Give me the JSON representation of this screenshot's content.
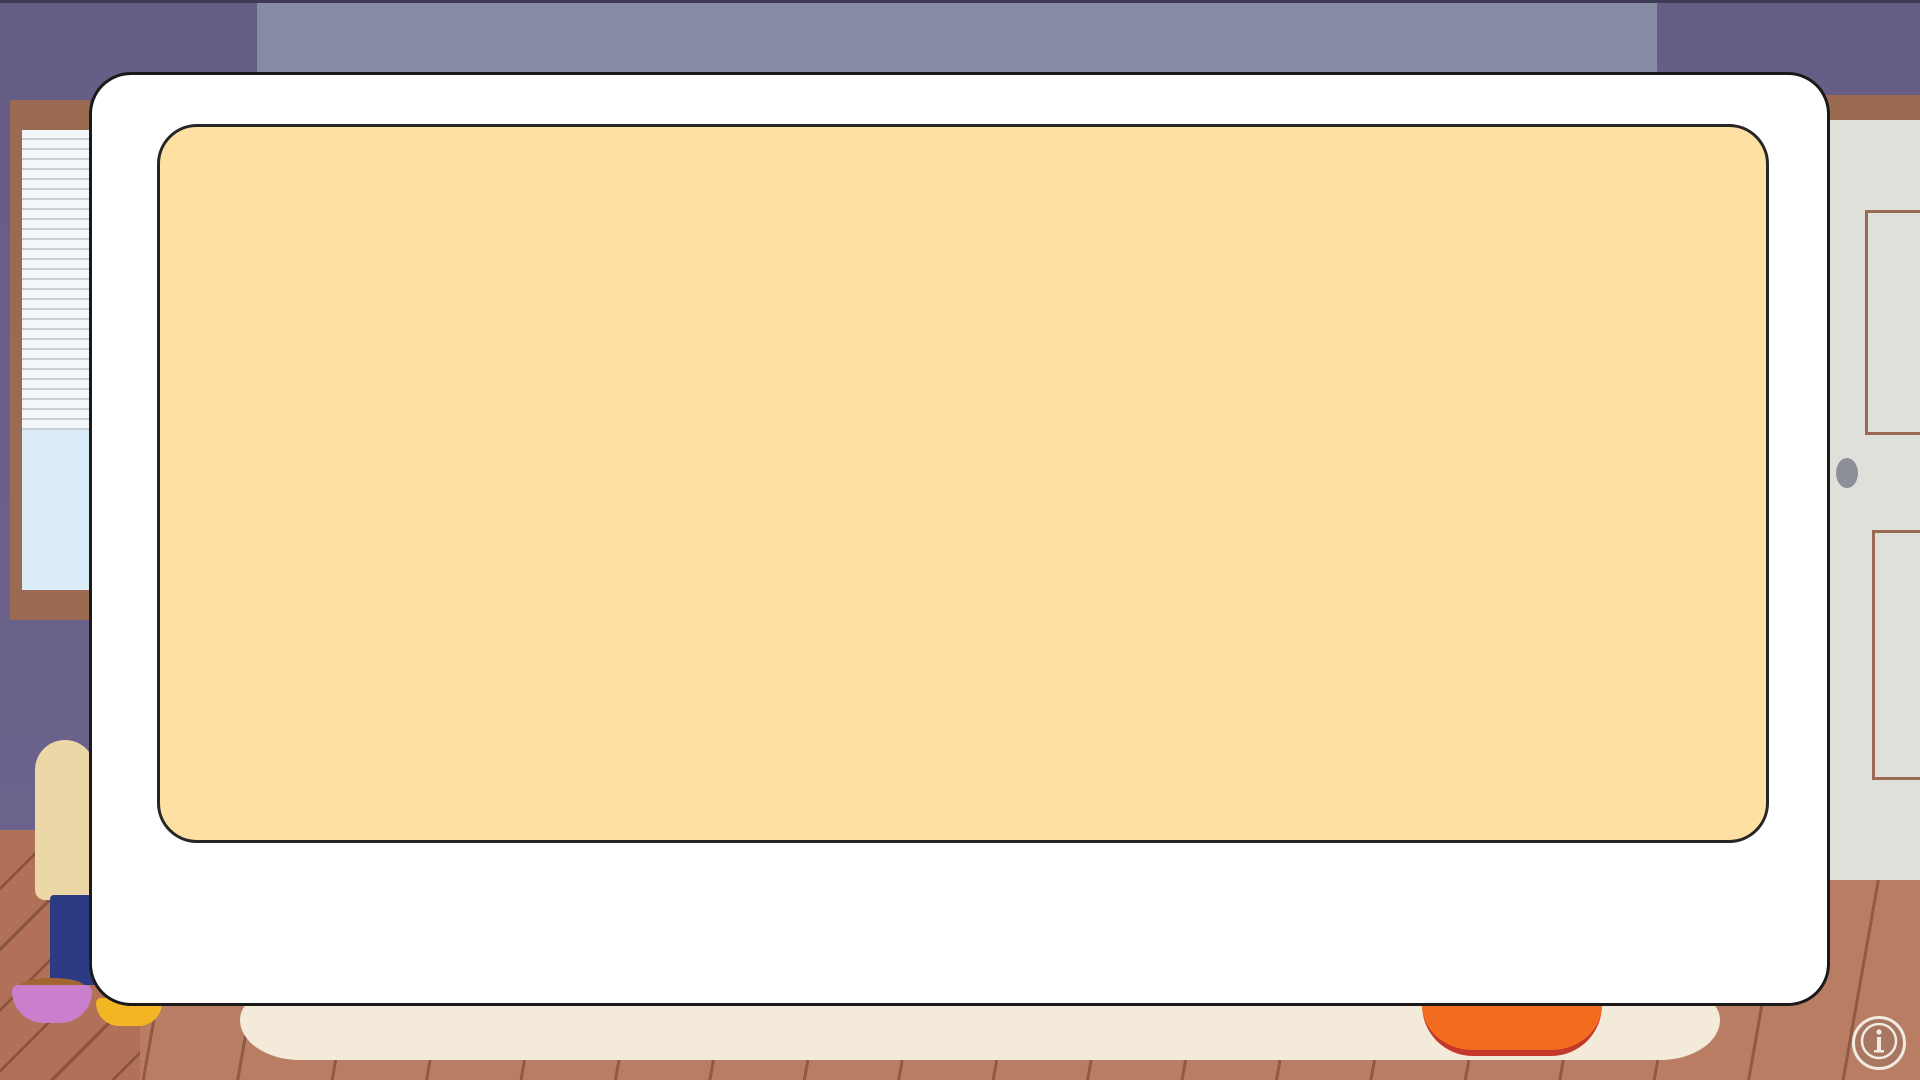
{
  "dialog": {
    "message": ""
  },
  "info_button": {
    "icon": "info-icon"
  },
  "colors": {
    "wall": "#655d86",
    "dialog_outer": "#ffffff",
    "dialog_inner": "#ffe0a3",
    "floor": "#b87d63"
  }
}
